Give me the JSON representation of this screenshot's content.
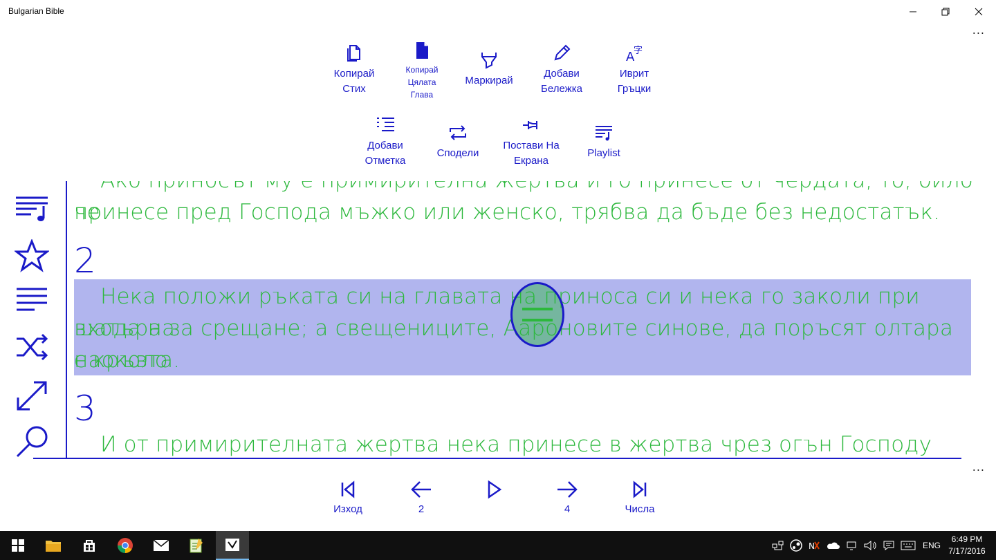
{
  "window": {
    "title": "Bulgarian Bible",
    "minimize_icon": "minimize-icon",
    "maximize_icon": "restore-icon",
    "close_icon": "close-icon",
    "more": "..."
  },
  "command_bar": [
    {
      "label": "Копирай\nСтих",
      "icon": "copy-icon"
    },
    {
      "label": "Копирай\nЦялата\nГлава",
      "icon": "document-icon"
    },
    {
      "label": "Маркирай",
      "icon": "highlighter-icon"
    },
    {
      "label": "Добави\nБележка",
      "icon": "pencil-icon"
    },
    {
      "label": "Иврит\nГръцки",
      "icon": "translate-icon"
    },
    {
      "label": "Добави\nОтметка",
      "icon": "bookmark-list-icon"
    },
    {
      "label": "Сподели",
      "icon": "share-icon"
    },
    {
      "label": "Постави На\nЕкрана",
      "icon": "pin-icon"
    },
    {
      "label": "Playlist",
      "icon": "playlist-icon"
    }
  ],
  "sidebar": [
    {
      "icon": "playlist-icon"
    },
    {
      "icon": "star-icon"
    },
    {
      "icon": "list-icon"
    },
    {
      "icon": "shuffle-icon"
    },
    {
      "icon": "expand-icon"
    },
    {
      "icon": "search-icon"
    }
  ],
  "reading": {
    "verse1_line1": "Ако приносът му е примирителна жертва и го принесе от чердата, то, било че",
    "verse1_line2": "принесе пред Господа мъжко или женско, трябва да бъде без недостатък.",
    "verse2_number": "2",
    "verse2_line1": "Нека положи ръката си на главата на приноса си и нека го заколи при входа на",
    "verse2_line2": "шатъра за срещане; а свещениците, Аароновите синове, да поръсят олтара наоколо",
    "verse2_line3": "с кръвта.",
    "verse3_number": "3",
    "verse3_line1": "И от примирителната жертва нека принесе в жертва чрез огън Господу",
    "highlight_color": "#b1b5ee",
    "text_color": "#2db83d",
    "accent_color": "#1a1ac8"
  },
  "bottom_nav": [
    {
      "label": "Изход",
      "icon": "skip-back-icon"
    },
    {
      "label": "2",
      "icon": "arrow-left-icon"
    },
    {
      "label": "",
      "icon": "play-icon"
    },
    {
      "label": "4",
      "icon": "arrow-right-icon"
    },
    {
      "label": "Числа",
      "icon": "skip-forward-icon"
    }
  ],
  "taskbar": {
    "language": "ENG",
    "time": "6:49 PM",
    "date": "7/17/2016",
    "apps": [
      "windows-start-icon",
      "file-explorer-icon",
      "store-icon",
      "chrome-icon",
      "mail-icon",
      "notepad-icon",
      "bible-app-icon"
    ]
  }
}
